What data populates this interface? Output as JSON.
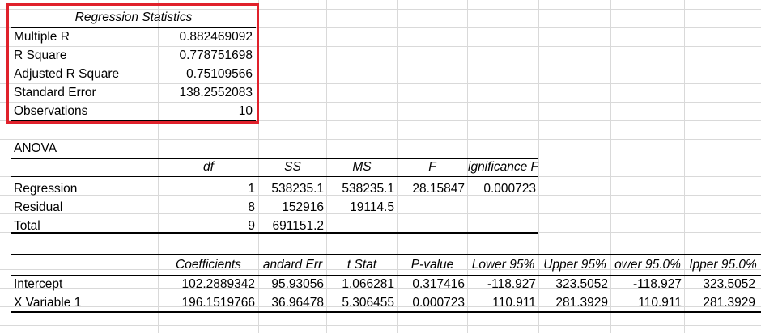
{
  "regression_statistics": {
    "title": "Regression Statistics",
    "rows": [
      {
        "label": "Multiple R",
        "value": "0.882469092"
      },
      {
        "label": "R Square",
        "value": "0.778751698"
      },
      {
        "label": "Adjusted R Square",
        "value": "0.75109566"
      },
      {
        "label": "Standard Error",
        "value": "138.2552083"
      },
      {
        "label": "Observations",
        "value": "10"
      }
    ]
  },
  "anova": {
    "title": "ANOVA",
    "headers": [
      "df",
      "SS",
      "MS",
      "F",
      "ignificance F"
    ],
    "rows": [
      {
        "label": "Regression",
        "cells": [
          "1",
          "538235.1",
          "538235.1",
          "28.15847",
          "0.000723"
        ]
      },
      {
        "label": "Residual",
        "cells": [
          "8",
          "152916",
          "19114.5",
          "",
          ""
        ]
      },
      {
        "label": "Total",
        "cells": [
          "9",
          "691151.2",
          "",
          "",
          ""
        ]
      }
    ]
  },
  "coefficients": {
    "headers": [
      "Coefficients",
      "andard Err",
      "t Stat",
      "P-value",
      "Lower 95%",
      "Upper 95%",
      "ower 95.0%",
      "Ipper 95.0%"
    ],
    "rows": [
      {
        "label": "Intercept",
        "cells": [
          "102.2889342",
          "95.93056",
          "1.066281",
          "0.317416",
          "-118.927",
          "323.5052",
          "-118.927",
          "323.5052"
        ]
      },
      {
        "label": "X Variable 1",
        "cells": [
          "196.1519766",
          "36.96478",
          "5.306455",
          "0.000723",
          "110.911",
          "281.3929",
          "110.911",
          "281.3929"
        ]
      }
    ]
  },
  "colors": {
    "highlight_border": "#e0212b",
    "gridline": "#d9d9d9"
  }
}
